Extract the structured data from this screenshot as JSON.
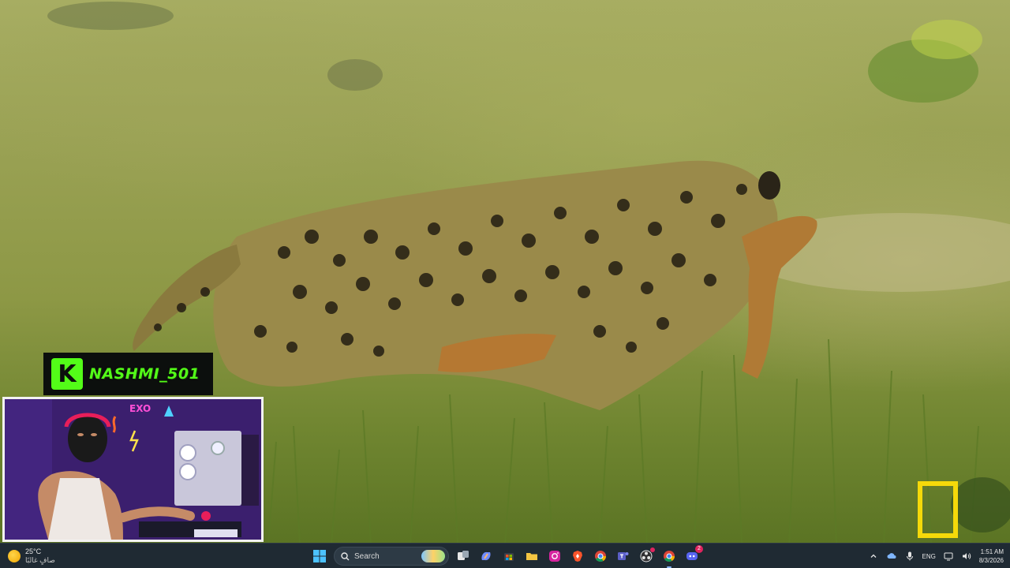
{
  "overlay": {
    "kick_logo_letter": "K",
    "streamer_name": "NASHMI_501"
  },
  "webcam": {
    "neon_sign_text": "EXO"
  },
  "taskbar": {
    "weather": {
      "temperature": "25°C",
      "description": "صافٍ غالبًا",
      "icon": "sun-icon"
    },
    "search": {
      "label": "Search"
    },
    "pinned_apps": [
      {
        "name": "start",
        "icon": "windows-logo-icon"
      },
      {
        "name": "task-view",
        "icon": "task-view-icon"
      },
      {
        "name": "copilot",
        "icon": "copilot-icon"
      },
      {
        "name": "store",
        "icon": "store-icon"
      },
      {
        "name": "file-explorer",
        "icon": "folder-icon"
      },
      {
        "name": "instagram",
        "icon": "instagram-icon"
      },
      {
        "name": "brave",
        "icon": "brave-icon"
      },
      {
        "name": "chrome",
        "icon": "chrome-icon"
      },
      {
        "name": "teams",
        "icon": "teams-icon"
      },
      {
        "name": "obs",
        "icon": "obs-icon"
      },
      {
        "name": "chrome-active",
        "icon": "chrome-icon"
      },
      {
        "name": "discord",
        "icon": "discord-icon"
      }
    ],
    "discord_badge": "2",
    "tray": {
      "language": "ENG",
      "time": "1:51 AM",
      "date": "8/3/2026"
    },
    "colors": {
      "background": "#1f2a33",
      "accent": "#8ab4f8"
    }
  }
}
